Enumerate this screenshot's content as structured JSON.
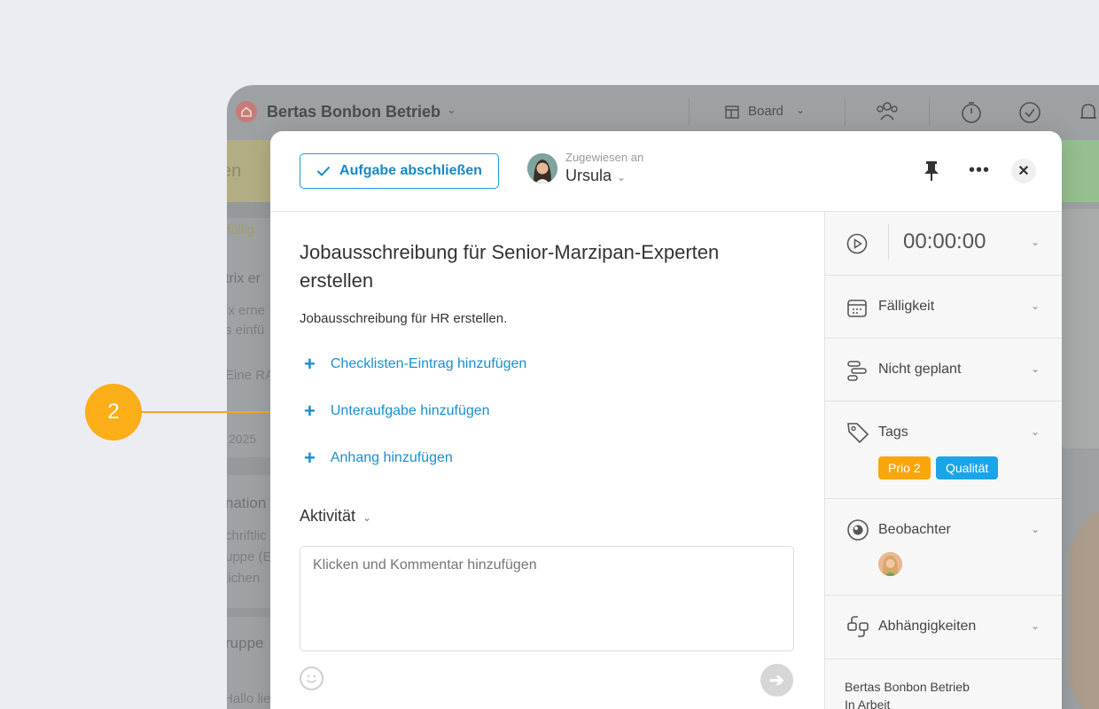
{
  "app": {
    "workspace_name": "Bertas Bonbon Betrieb",
    "view_label": "Board",
    "bg_column_header": "en",
    "bg_texts": [
      "fällig",
      "trix er",
      "ix erne",
      "s einfü",
      "Eine RA",
      "2025",
      "nation",
      "chriftlic",
      "uppe (E",
      "lichen",
      "ruppe",
      "Hallo lie"
    ]
  },
  "callout": {
    "number": "2"
  },
  "modal": {
    "complete_button": "Aufgabe abschließen",
    "assigned_caption": "Zugewiesen an",
    "assignee_name": "Ursula",
    "task_title": "Jobausschreibung für Senior-Marzipan-Experten erstellen",
    "description": "Jobausschreibung für HR erstellen.",
    "add_checklist": "Checklisten-Eintrag hinzufügen",
    "add_subtask": "Unteraufgabe hinzufügen",
    "add_attachment": "Anhang hinzufügen",
    "activity_label": "Aktivität",
    "comment_placeholder": "Klicken und Kommentar hinzufügen"
  },
  "sidebar": {
    "timer": "00:00:00",
    "due_label": "Fälligkeit",
    "schedule_label": "Nicht geplant",
    "tags_label": "Tags",
    "tags": [
      {
        "label": "Prio 2",
        "color": "#f8a60c"
      },
      {
        "label": "Qualität",
        "color": "#1aa5e8"
      }
    ],
    "watchers_label": "Beobachter",
    "dependencies_label": "Abhängigkeiten",
    "project_name": "Bertas Bonbon Betrieb",
    "project_status": "In Arbeit"
  },
  "colors": {
    "accent": "#1a8fd0",
    "callout": "#fbae17"
  }
}
